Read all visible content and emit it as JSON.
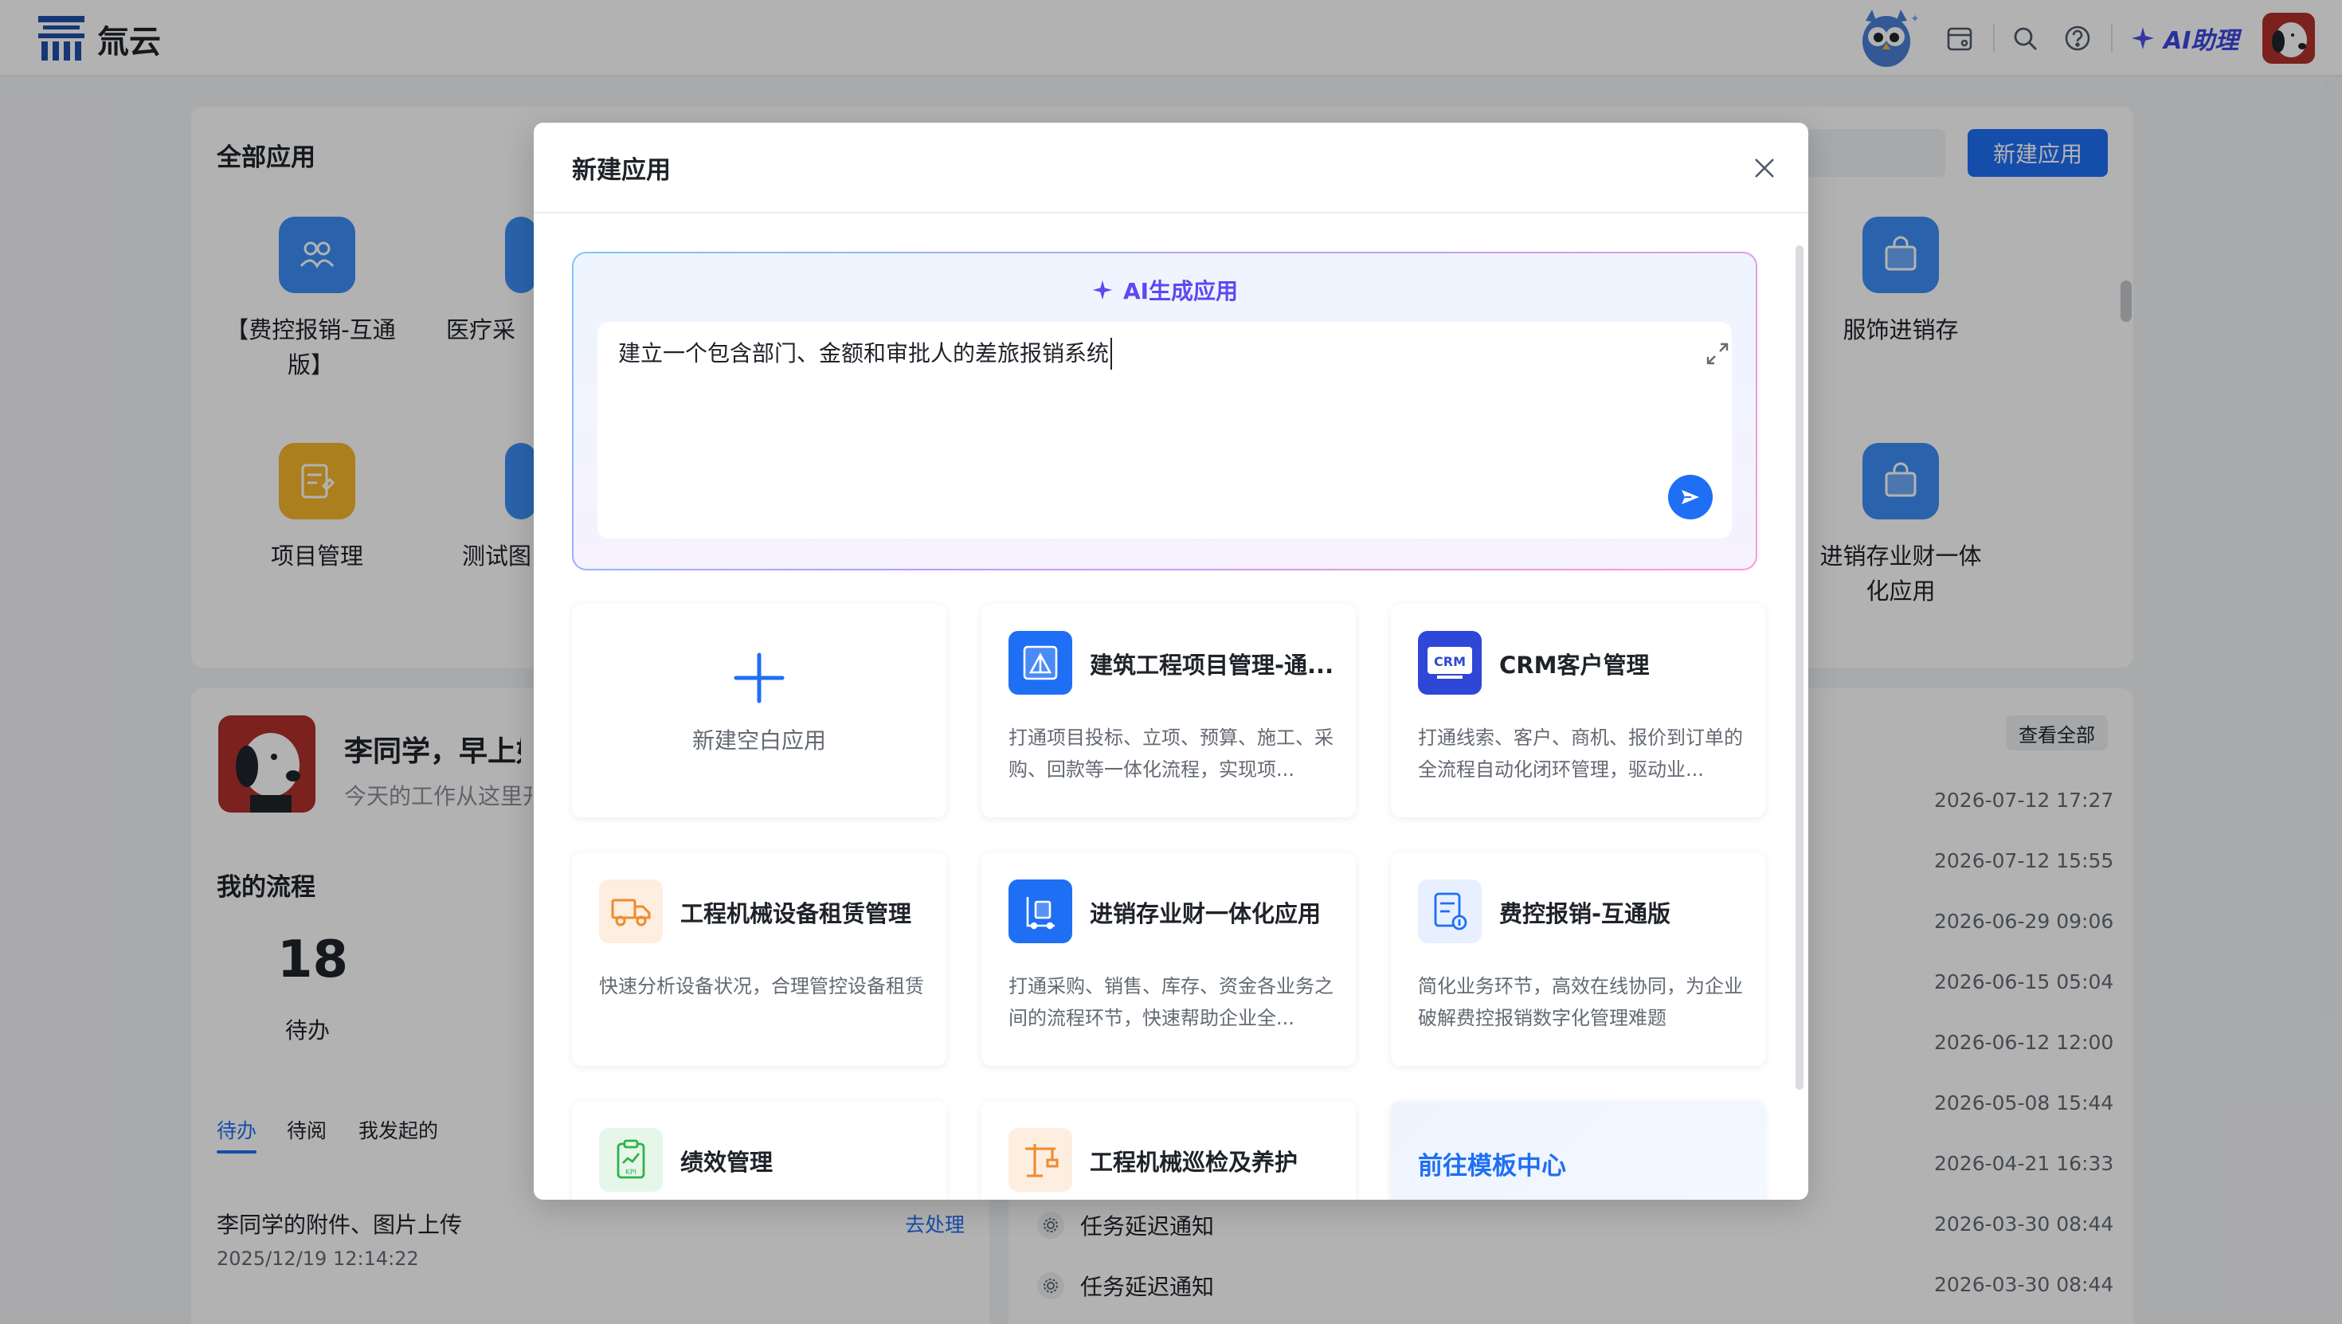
{
  "topbar": {
    "brand": "氚云",
    "ai_assistant": "AI助理"
  },
  "apps_panel": {
    "title": "全部应用",
    "new_app_button": "新建应用",
    "apps": [
      {
        "label": "【费控报销-互通版】",
        "color": "#3d8ef7"
      },
      {
        "label": "医疗采",
        "color": "#3d8ef7"
      },
      {
        "label": "服饰进销存",
        "color": "#3d8ef7"
      },
      {
        "label": "项目管理",
        "color": "#f5b52c"
      },
      {
        "label": "测试图",
        "color": "#3d8ef7"
      },
      {
        "label": "进销存业财一体化应用",
        "color": "#3d8ef7"
      }
    ]
  },
  "user_panel": {
    "greeting": "李同学，早上好",
    "subtitle": "今天的工作从这里开",
    "process_title": "我的流程",
    "pending_count": "18",
    "pending_label": "待办",
    "tabs": [
      "待办",
      "待阅",
      "我发起的"
    ],
    "task": {
      "name": "李同学的附件、图片上传",
      "time": "2025/12/19 12:14:22",
      "action": "去处理"
    }
  },
  "notices_panel": {
    "view_all": "查看全部",
    "dates": [
      "2026-07-12 17:27",
      "2026-07-12 15:55",
      "2026-06-29 09:06",
      "2026-06-15 05:04",
      "2026-06-12 12:00",
      "2026-05-08 15:44",
      "2026-04-21 16:33",
      "2026-03-30 08:44",
      "2026-03-30 08:44"
    ],
    "notices": [
      "任务延迟通知",
      "任务延迟通知"
    ]
  },
  "modal": {
    "title": "新建应用",
    "ai_section": {
      "title": "AI生成应用",
      "prompt_value": "建立一个包含部门、金额和审批人的差旅报销系统"
    },
    "blank_app_label": "新建空白应用",
    "templates": [
      {
        "title": "建筑工程项目管理-通...",
        "desc": "打通项目投标、立项、预算、施工、采购、回款等一体化流程，实现项...",
        "icon": "construction-icon",
        "color": "#1f6ff5"
      },
      {
        "title": "CRM客户管理",
        "desc": "打通线索、客户、商机、报价到订单的全流程自动化闭环管理，驱动业...",
        "icon": "crm-icon",
        "color": "#2e47d6"
      },
      {
        "title": "工程机械设备租赁管理",
        "desc": "快速分析设备状况，合理管控设备租赁",
        "icon": "truck-icon",
        "color": "#fdeee0"
      },
      {
        "title": "进销存业财一体化应用",
        "desc": "打通采购、销售、库存、资金各业务之间的流程环节，快速帮助企业全...",
        "icon": "inventory-icon",
        "color": "#1f6ff5"
      },
      {
        "title": "费控报销-互通版",
        "desc": "简化业务环节，高效在线协同，为企业破解费控报销数字化管理难题",
        "icon": "expense-icon",
        "color": "#e8f0ff"
      },
      {
        "title": "绩效管理",
        "desc": "",
        "icon": "kpi-icon",
        "color": "#e6f7ea"
      },
      {
        "title": "工程机械巡检及养护",
        "desc": "",
        "icon": "crane-icon",
        "color": "#fdeee0"
      }
    ],
    "template_center_link": "前往模板中心"
  }
}
